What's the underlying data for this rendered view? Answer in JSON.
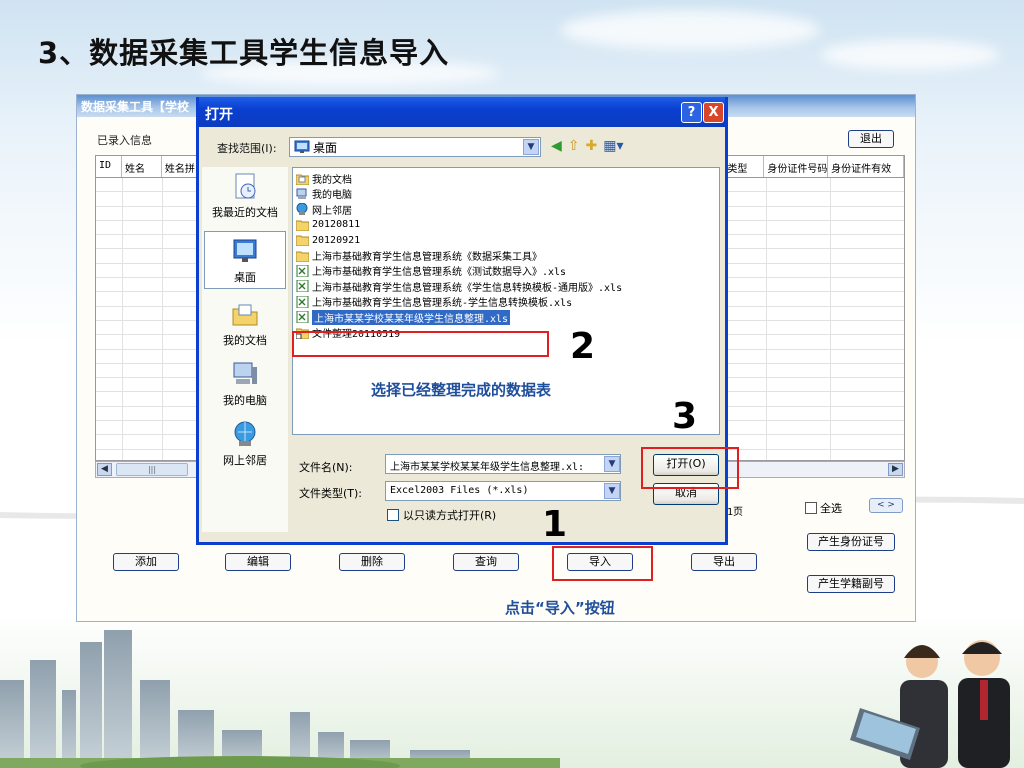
{
  "slide": {
    "title": "3、数据采集工具学生信息导入"
  },
  "app": {
    "title": "数据采集工具【学校",
    "entered_label": "已录入信息",
    "exit_button": "退出",
    "columns_left": [
      "ID",
      "姓名",
      "姓名拼"
    ],
    "columns_right": [
      "类型",
      "身份证件号码",
      "身份证件有效"
    ],
    "pager_text": "1页",
    "select_all": "全选",
    "pager_nav": "< >",
    "buttons": {
      "add": "添加",
      "edit": "编辑",
      "delete": "删除",
      "query": "查询",
      "import": "导入",
      "export": "导出",
      "gen_id": "产生身份证号",
      "gen_student_no": "产生学籍副号"
    }
  },
  "dialog": {
    "title": "打开",
    "help": "?",
    "close": "X",
    "look_in_label": "查找范围(I):",
    "look_in_value": "桌面",
    "places": [
      "我最近的文档",
      "桌面",
      "我的文档",
      "我的电脑",
      "网上邻居"
    ],
    "files": [
      {
        "name": "我的文档",
        "type": "folder-doc"
      },
      {
        "name": "我的电脑",
        "type": "computer"
      },
      {
        "name": "网上邻居",
        "type": "network"
      },
      {
        "name": "20120811",
        "type": "folder"
      },
      {
        "name": "20120921",
        "type": "folder"
      },
      {
        "name": "上海市基础教育学生信息管理系统《数据采集工具》",
        "type": "folder"
      },
      {
        "name": "上海市基础教育学生信息管理系统《测试数据导入》.xls",
        "type": "excel"
      },
      {
        "name": "上海市基础教育学生信息管理系统《学生信息转换模板-通用版》.xls",
        "type": "excel"
      },
      {
        "name": "上海市基础教育学生信息管理系统-学生信息转换模板.xls",
        "type": "excel"
      },
      {
        "name": "上海市某某学校某某年级学生信息整理.xls",
        "type": "excel",
        "selected": true
      },
      {
        "name": "文件整理20110519",
        "type": "shortcut"
      }
    ],
    "file_name_label": "文件名(N):",
    "file_name_value": "上海市某某学校某某年级学生信息整理.xl:",
    "file_type_label": "文件类型(T):",
    "file_type_value": "Excel2003 Files (*.xls)",
    "readonly_label": "以只读方式打开(R)",
    "open_button": "打开(O)",
    "cancel_button": "取消"
  },
  "annotations": {
    "choose_hint": "选择已经整理完成的数据表",
    "click_hint": "点击“导入”按钮",
    "step1": "1",
    "step2": "2",
    "step3": "3"
  }
}
